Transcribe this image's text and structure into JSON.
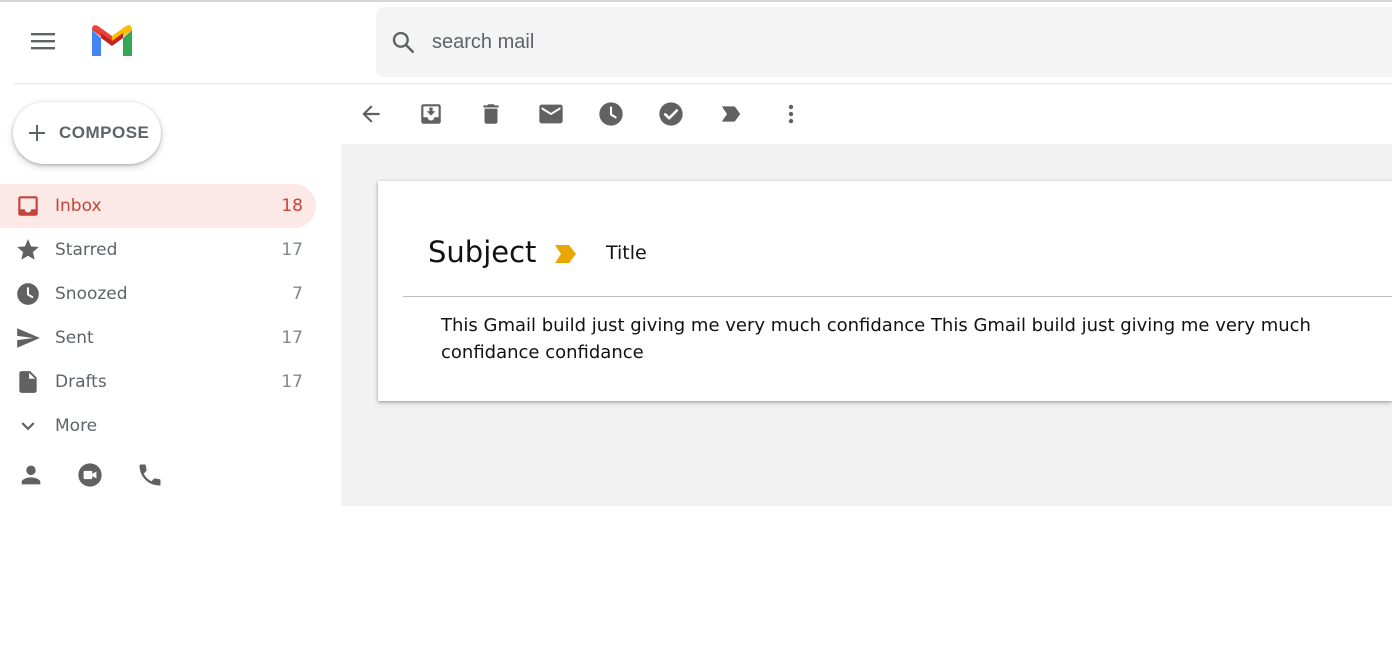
{
  "header": {
    "search_placeholder": "search mail"
  },
  "sidebar": {
    "compose_label": "COMPOSE",
    "items": [
      {
        "label": "Inbox",
        "count": "18",
        "icon": "inbox-icon",
        "active": true
      },
      {
        "label": "Starred",
        "count": "17",
        "icon": "star-icon"
      },
      {
        "label": "Snoozed",
        "count": "7",
        "icon": "clock-icon"
      },
      {
        "label": "Sent",
        "count": "17",
        "icon": "send-icon"
      },
      {
        "label": "Drafts",
        "count": "17",
        "icon": "draft-icon"
      },
      {
        "label": "More",
        "count": "",
        "icon": "chevron-down-icon"
      }
    ],
    "bottom_icons": [
      "person-icon",
      "video-icon",
      "phone-icon"
    ]
  },
  "toolbar": {
    "icons": [
      "back-arrow-icon",
      "archive-icon",
      "trash-icon",
      "mail-icon",
      "clock-icon",
      "check-circle-icon",
      "label-icon",
      "more-vert-icon"
    ]
  },
  "email": {
    "subject": "Subject",
    "title": "Title",
    "body": "This Gmail build just giving me very much confidance This Gmail build just giving me very much confidance confidance"
  },
  "colors": {
    "accent": "#c5453a",
    "active_bg": "#fce8e6",
    "icon_gray": "#616161",
    "tag_yellow": "#f4b400",
    "content_bg": "#f2f2f2"
  }
}
